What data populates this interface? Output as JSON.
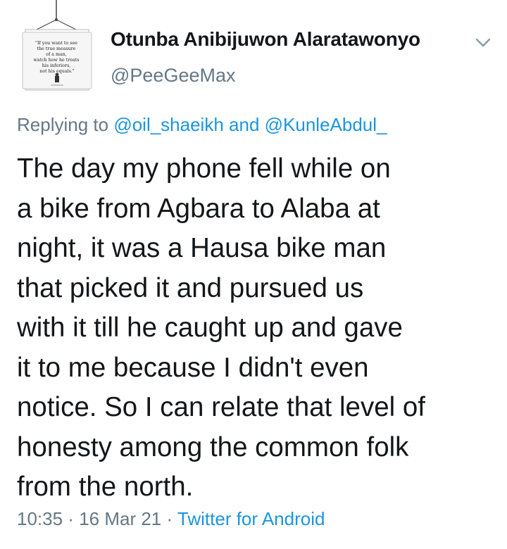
{
  "author": {
    "display_name": "Otunba Anibijuwon Alaratawonyo",
    "handle": "@PeeGeeMax",
    "avatar_quote": [
      "\"If you want to see",
      "the true measure",
      "of a man,",
      "watch how he treats",
      "his inferiors,",
      "not his equals.\""
    ]
  },
  "reply": {
    "prefix": "Replying to",
    "mention_1": "@oil_shaeikh",
    "conjunction": "and",
    "mention_2": "@KunleAbdul_"
  },
  "tweet": {
    "text": "The day my phone fell while on\na bike from Agbara to Alaba at\nnight, it was a Hausa bike man\nthat picked it and pursued us\nwith it till he caught up and gave\nit to me because I didn't even\nnotice.  So I can relate that level of\nhonesty among the common folk\nfrom the north."
  },
  "meta": {
    "time": "10:35",
    "separator_1": " · ",
    "date": "16 Mar 21",
    "separator_2": " · ",
    "source": "Twitter for Android"
  },
  "icons": {
    "caret": "chevron-down-icon"
  },
  "colors": {
    "text_primary": "#14171a",
    "text_secondary": "#657786",
    "link": "#1b95e0"
  }
}
